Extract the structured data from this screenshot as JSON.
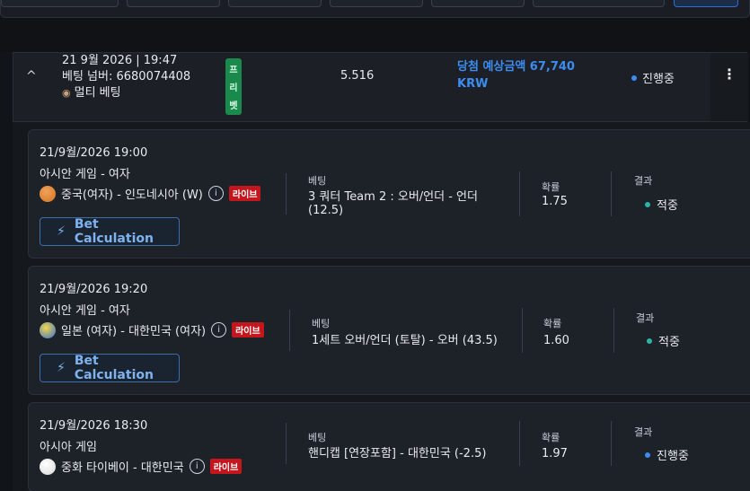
{
  "bet": {
    "datetime": "21 9월 2026 | 19:47",
    "bet_number": "베팅 넘버: 6680074408",
    "type": "멀티 베팅",
    "free_tag": [
      "프",
      "리",
      "벳"
    ],
    "odds": "5.516",
    "win_line1": "당첨 예상금액 67,740",
    "win_line2": "KRW",
    "status": "진행중",
    "more": "⋮",
    "chevron": "^"
  },
  "labels": {
    "bet": "베팅",
    "odds": "확률",
    "result": "결과",
    "calc": "Bet Calculation",
    "live": "라이브",
    "info": "i"
  },
  "selections": [
    {
      "date": "21/9월/2026 19:00",
      "league": "아시안 게임 - 여자",
      "match": "중국(여자) - 인도네시아 (W)",
      "sport_icon": "basketball-icon",
      "bet_line1": "3 쿼터 Team 2 : 오버/언더 - 언더",
      "bet_line2": "(12.5)",
      "odds": "1.75",
      "result": "적중"
    },
    {
      "date": "21/9월/2026 19:20",
      "league": "아시안 게임 - 여자",
      "match": "일본 (여자) - 대한민국 (여자)",
      "sport_icon": "volleyball-icon",
      "bet_line1": "1세트 오버/언더 (토탈) - 오버 (43.5)",
      "bet_line2": "",
      "odds": "1.60",
      "result": "적중"
    },
    {
      "date": "21/9월/2026 18:30",
      "league": "아시아 게임",
      "match": "중화 타이베이 - 대한민국",
      "sport_icon": "baseball-icon",
      "bet_line1": "핸디캡 [연장포함] - 대한민국 (-2.5)",
      "bet_line2": "",
      "odds": "1.97",
      "result": "진행중"
    }
  ]
}
